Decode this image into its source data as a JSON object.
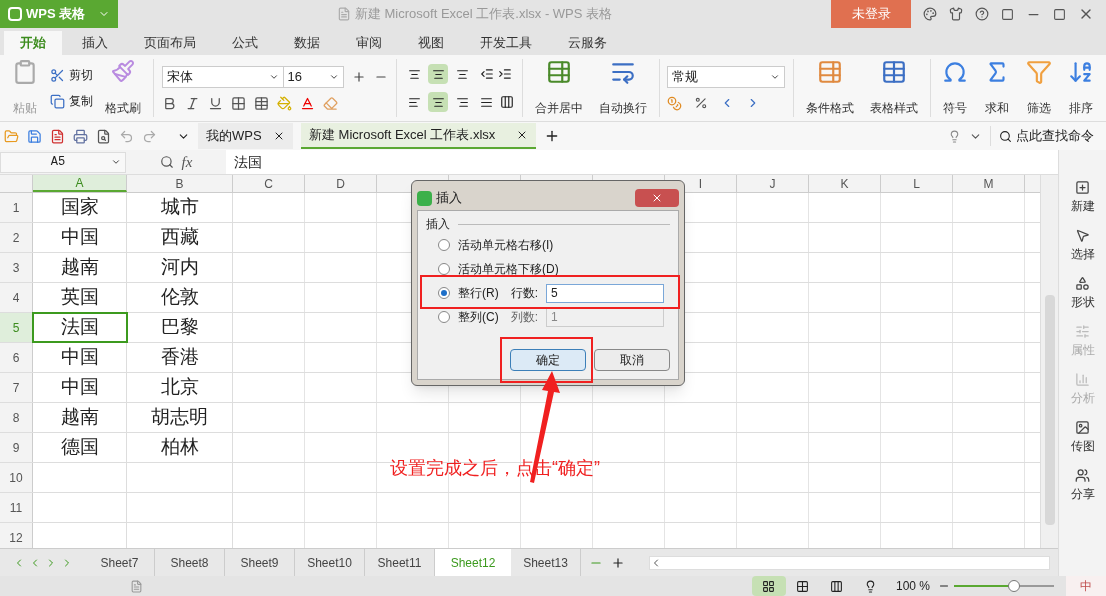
{
  "app": {
    "logo_label": "WPS 表格",
    "title": "新建 Microsoft Excel 工作表.xlsx - WPS 表格",
    "login_button": "未登录"
  },
  "menu_tabs": [
    {
      "label": "开始",
      "selected": true
    },
    {
      "label": "插入",
      "selected": false
    },
    {
      "label": "页面布局",
      "selected": false
    },
    {
      "label": "公式",
      "selected": false
    },
    {
      "label": "数据",
      "selected": false
    },
    {
      "label": "审阅",
      "selected": false
    },
    {
      "label": "视图",
      "selected": false
    },
    {
      "label": "开发工具",
      "selected": false
    },
    {
      "label": "云服务",
      "selected": false
    }
  ],
  "ribbon": {
    "paste": {
      "label": "粘贴",
      "disabled": true
    },
    "cut": "剪切",
    "copy": "复制",
    "format_painter": "格式刷",
    "font": {
      "name": "宋体",
      "size": "16"
    },
    "vertical_align": [
      {
        "selected": false
      },
      {
        "selected": true
      },
      {
        "selected": false
      }
    ],
    "horizontal_align": [
      {
        "selected": false
      },
      {
        "selected": true
      },
      {
        "selected": false
      },
      {
        "selected": false
      }
    ],
    "merge_center": "合并居中",
    "wrap_text": "自动换行",
    "number_format": "常规",
    "conditional_format": "条件格式",
    "table_style": "表格样式",
    "tools": [
      "符号",
      "求和",
      "筛选",
      "排序"
    ]
  },
  "doc_bar": {
    "tabs": [
      {
        "label": "我的WPS",
        "selected": false
      },
      {
        "label": "新建 Microsoft Excel 工作表.xlsx",
        "selected": true
      }
    ],
    "search_placeholder": "点此查找命令"
  },
  "formula_bar": {
    "name_box": "A5",
    "fx": "fx",
    "value": "法国"
  },
  "grid": {
    "columns_left": [
      {
        "label": "A",
        "selected": true
      },
      {
        "label": "B",
        "selected": false
      },
      {
        "label": "C",
        "selected": false
      },
      {
        "label": "D",
        "selected": false
      }
    ],
    "columns_right": [
      {
        "label": "I",
        "selected": false
      },
      {
        "label": "J",
        "selected": false
      },
      {
        "label": "K",
        "selected": false
      },
      {
        "label": "L",
        "selected": false
      },
      {
        "label": "M",
        "selected": false
      }
    ],
    "rows": [
      {
        "number": "1",
        "a": "国家",
        "b": "城市",
        "selected": false
      },
      {
        "number": "2",
        "a": "中国",
        "b": "西藏",
        "selected": false
      },
      {
        "number": "3",
        "a": "越南",
        "b": "河内",
        "selected": false
      },
      {
        "number": "4",
        "a": "英国",
        "b": "伦敦",
        "selected": false
      },
      {
        "number": "5",
        "a": "法国",
        "b": "巴黎",
        "selected": true
      },
      {
        "number": "6",
        "a": "中国",
        "b": "香港",
        "selected": false
      },
      {
        "number": "7",
        "a": "中国",
        "b": "北京",
        "selected": false
      },
      {
        "number": "8",
        "a": "越南",
        "b": "胡志明",
        "selected": false
      },
      {
        "number": "9",
        "a": "德国",
        "b": "柏林",
        "selected": false
      },
      {
        "number": "10",
        "selected": false
      },
      {
        "number": "11",
        "selected": false
      },
      {
        "number": "12",
        "selected": false
      }
    ]
  },
  "dialog": {
    "title": "插入",
    "group_label": "插入",
    "options": [
      {
        "label": "活动单元格右移(I)",
        "selected": false
      },
      {
        "label": "活动单元格下移(D)",
        "selected": false
      },
      {
        "label": "整行(R)",
        "selected": true,
        "count_label": "行数:",
        "count": "5",
        "disabled": false
      },
      {
        "label": "整列(C)",
        "selected": false,
        "count_label": "列数:",
        "count": "1",
        "disabled": true
      }
    ],
    "buttons": [
      {
        "label": "确定",
        "default": true
      },
      {
        "label": "取消",
        "default": false
      }
    ]
  },
  "annotation": {
    "text": "设置完成之后，点击“确定”"
  },
  "sidebar": [
    {
      "label": "新建",
      "disabled": false
    },
    {
      "label": "选择",
      "disabled": false
    },
    {
      "label": "形状",
      "disabled": false
    },
    {
      "label": "属性",
      "disabled": true
    },
    {
      "label": "分析",
      "disabled": true
    },
    {
      "label": "传图",
      "disabled": false
    },
    {
      "label": "分享",
      "disabled": false
    }
  ],
  "sheet_tabs": [
    {
      "label": "Sheet7",
      "selected": false
    },
    {
      "label": "Sheet8",
      "selected": false
    },
    {
      "label": "Sheet9",
      "selected": false
    },
    {
      "label": "Sheet10",
      "selected": false
    },
    {
      "label": "Sheet11",
      "selected": false
    },
    {
      "label": "Sheet12",
      "selected": true
    },
    {
      "label": "Sheet13",
      "selected": false
    }
  ],
  "status_bar": {
    "zoom": "100 %",
    "zoom_slider": {
      "level": 0.6
    },
    "ime": "中"
  }
}
